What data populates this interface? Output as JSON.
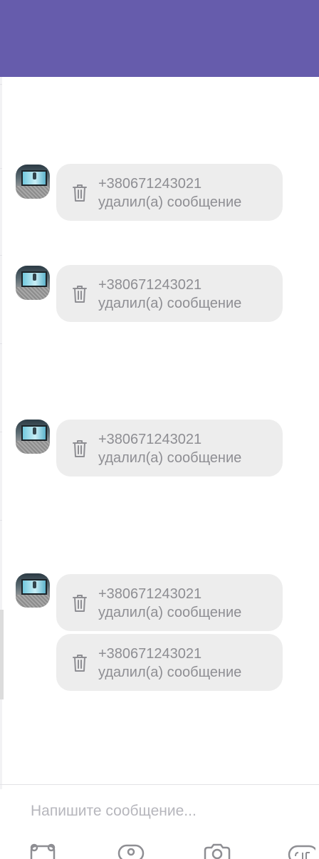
{
  "header": {
    "bg": "#665cac"
  },
  "messages": [
    {
      "sender": "+380671243021",
      "status": "удалил(а) сообщение",
      "icon": "trash-icon"
    },
    {
      "sender": "+380671243021",
      "status": "удалил(а) сообщение",
      "icon": "trash-icon"
    },
    {
      "sender": "+380671243021",
      "status": "удалил(а) сообщение",
      "icon": "trash-icon"
    },
    {
      "sender": "+380671243021",
      "status": "удалил(а) сообщение",
      "icon": "trash-icon"
    },
    {
      "sender": "+380671243021",
      "status": "удалил(а) сообщение",
      "icon": "trash-icon"
    }
  ],
  "composer": {
    "placeholder": "Напишите сообщение..."
  },
  "toolbar": {
    "icons": [
      "sticker-icon",
      "mention-icon",
      "camera-icon",
      "gif-icon"
    ]
  },
  "colors": {
    "accent": "#665cac",
    "bubble": "#ededed",
    "muted_text": "#8e8e93"
  }
}
